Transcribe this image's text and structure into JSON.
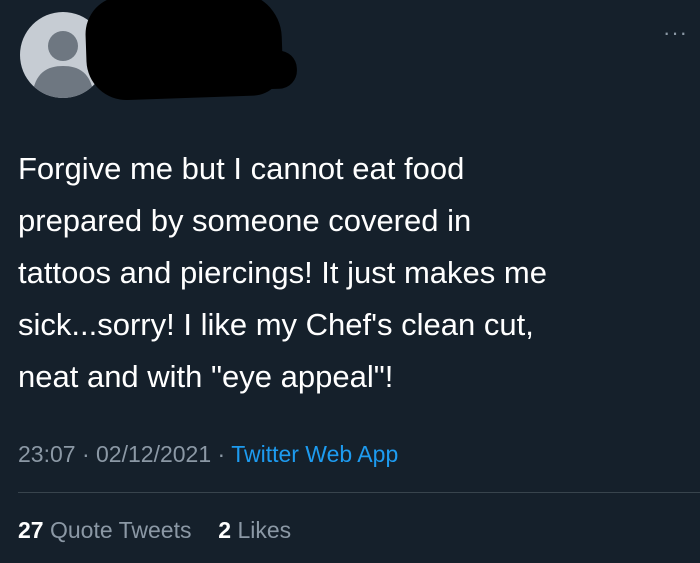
{
  "tweet": {
    "text": "Forgive me but I cannot eat food\nprepared by someone covered in\ntattoos and piercings! It just makes me\nsick...sorry! I like my Chef's clean cut,\nneat and with \"eye appeal\"!",
    "time": "23:07",
    "date": "02/12/2021",
    "separator": "·",
    "source": "Twitter Web App",
    "more_icon": "···"
  },
  "stats": {
    "quote_tweets_count": "27",
    "quote_tweets_label": "Quote Tweets",
    "likes_count": "2",
    "likes_label": "Likes"
  },
  "colors": {
    "background": "#15202b",
    "text": "#ffffff",
    "secondary_text": "#8b98a5",
    "link": "#1d9bf0",
    "divider": "#38444d"
  },
  "icons": {
    "avatar": "default-avatar-icon",
    "more": "more-options-icon"
  }
}
